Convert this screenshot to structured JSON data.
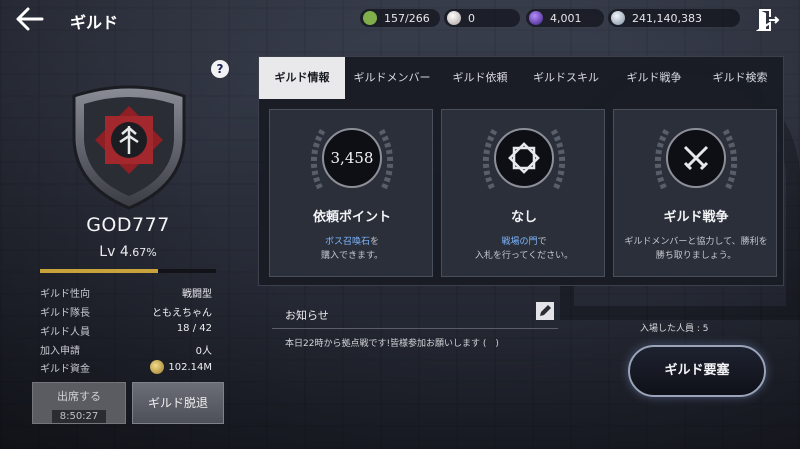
{
  "header": {
    "title": "ギルド",
    "resources": [
      {
        "name": "stamina",
        "value": "157/266",
        "color": "#7fae4a"
      },
      {
        "name": "pearl",
        "value": "0",
        "color": "#d9d2cc"
      },
      {
        "name": "purple-gem",
        "value": "4,001",
        "color": "#6a3dbf"
      },
      {
        "name": "silver",
        "value": "241,140,383",
        "color": "#b9c7d6"
      }
    ]
  },
  "guild": {
    "name": "GOD777",
    "level_label": "Lv 4",
    "level_percent": ".67%",
    "xp_fraction": 0.67,
    "info": [
      {
        "key": "ギルド性向",
        "value": "戦闘型"
      },
      {
        "key": "ギルド隊長",
        "value": "ともえちゃん"
      },
      {
        "key": "ギルド人員",
        "value": "18 / 42"
      },
      {
        "key": "加入申請",
        "value": "0人"
      },
      {
        "key": "ギルド資金",
        "value": "102.14M"
      }
    ]
  },
  "buttons": {
    "attend_label": "出席する",
    "attend_timer": "8:50:27",
    "leave_label": "ギルド脱退",
    "fortress_label": "ギルド要塞"
  },
  "tabs": [
    "ギルド情報",
    "ギルドメンバー",
    "ギルド依頼",
    "ギルドスキル",
    "ギルド戦争",
    "ギルド検索"
  ],
  "cards": [
    {
      "circle_text": "3,458",
      "title": "依頼ポイント",
      "desc_highlight": "ボス召喚石",
      "desc_rest": "を",
      "desc_line2": "購入できます。"
    },
    {
      "circle_text": "",
      "title": "なし",
      "desc_highlight": "戦場の門",
      "desc_rest": "で",
      "desc_line2": "入札を行ってください。"
    },
    {
      "circle_text": "",
      "title": "ギルド戦争",
      "desc_highlight": "",
      "desc_rest": "ギルドメンバーと協力して、勝利を",
      "desc_line2": "勝ち取りましょう。"
    }
  ],
  "notice": {
    "title": "お知らせ",
    "text": "本日22時から拠点戦です!皆様参加お願いします (　)"
  },
  "entered_label": "入場した人員 : 5",
  "accent_color": "#c8a23a"
}
